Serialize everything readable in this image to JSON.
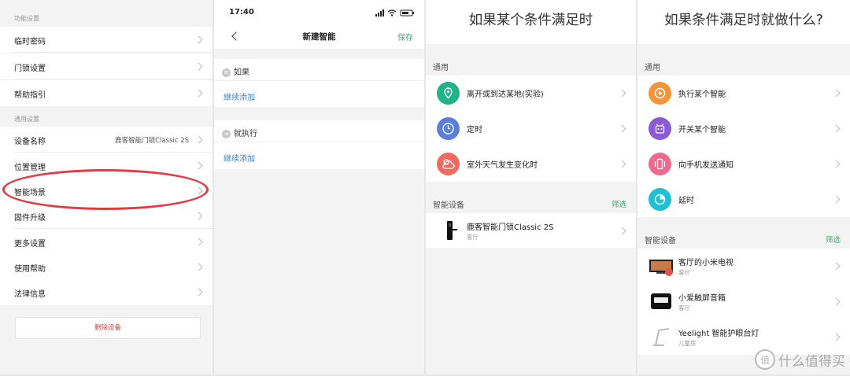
{
  "colors": {
    "accent_green": "#3aaf6e",
    "link_blue": "#3a7ec8",
    "danger_red": "#d9453b",
    "annotation_red": "#e23b45"
  },
  "panel1": {
    "section1": "功能设置",
    "items1": [
      {
        "label": "临时密码"
      },
      {
        "label": "门锁设置"
      },
      {
        "label": "帮助指引"
      }
    ],
    "section2": "通用设置",
    "items2": [
      {
        "label": "设备名称",
        "value": "鹿客智能门锁Classic 2S"
      },
      {
        "label": "位置管理"
      },
      {
        "label": "智能场景"
      },
      {
        "label": "固件升级"
      },
      {
        "label": "更多设置"
      },
      {
        "label": "使用帮助"
      },
      {
        "label": "法律信息"
      }
    ],
    "delete_label": "删除设备"
  },
  "panel2": {
    "status_time": "17:40",
    "nav_title": "新建智能",
    "save_label": "保存",
    "if_label": "如果",
    "then_label": "就执行",
    "add_more": "继续添加"
  },
  "panel3": {
    "title": "如果某个条件满足时",
    "group_general": "通用",
    "general_items": [
      {
        "label": "离开或到达某地(实验)",
        "icon": "location-icon",
        "color": "#1fb38a"
      },
      {
        "label": "定时",
        "icon": "clock-icon",
        "color": "#5b7fd8"
      },
      {
        "label": "室外天气发生变化时",
        "icon": "weather-icon",
        "color": "#f06a62"
      }
    ],
    "group_devices": "智能设备",
    "filter_label": "筛选",
    "devices": [
      {
        "label": "鹿客智能门锁Classic 2S",
        "room": "客厅"
      }
    ]
  },
  "panel4": {
    "title": "如果条件满足时就做什么?",
    "group_general": "通用",
    "general_items": [
      {
        "label": "执行某个智能",
        "icon": "smart-icon",
        "color": "#f7943a"
      },
      {
        "label": "开关某个智能",
        "icon": "robot-icon",
        "color": "#8a5bd6"
      },
      {
        "label": "向手机发送通知",
        "icon": "phone-vibrate-icon",
        "color": "#ee6a8f"
      },
      {
        "label": "延时",
        "icon": "timer-icon",
        "color": "#1fc0d6"
      }
    ],
    "group_devices": "智能设备",
    "filter_label": "筛选",
    "devices": [
      {
        "label": "客厅的小米电视",
        "room": "客厅"
      },
      {
        "label": "小爱触屏音箱",
        "room": "客厅"
      },
      {
        "label": "Yeelight 智能护眼台灯",
        "room": "儿童房"
      }
    ]
  },
  "watermark": {
    "text": "什么值得买",
    "logo": "值"
  }
}
